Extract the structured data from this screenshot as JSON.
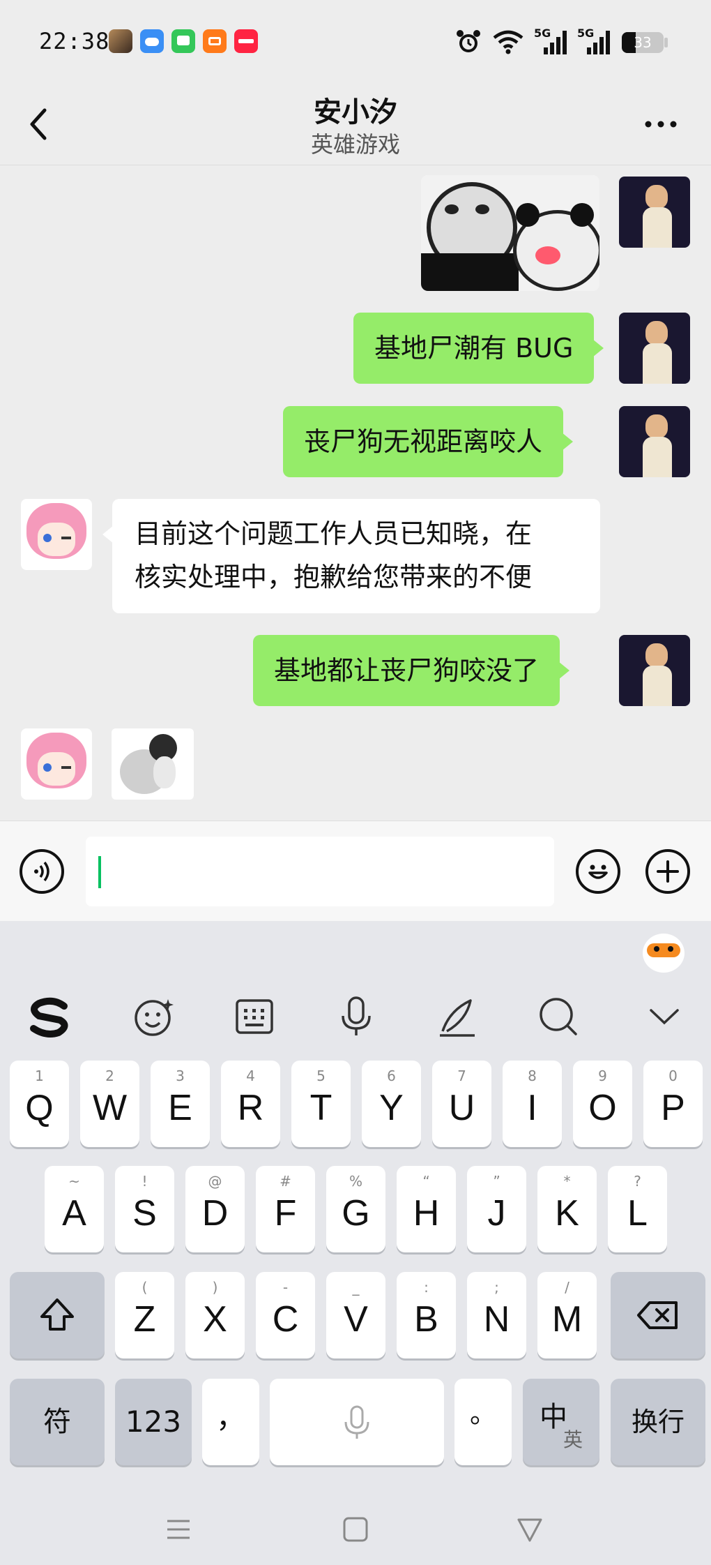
{
  "status": {
    "time": "22:38",
    "signal1": "5G",
    "signal2": "5G",
    "battery": "33"
  },
  "header": {
    "title": "安小汐",
    "subtitle": "英雄游戏"
  },
  "messages": [
    {
      "side": "right",
      "kind": "sticker"
    },
    {
      "side": "right",
      "text": "基地尸潮有 BUG"
    },
    {
      "side": "right",
      "text": "丧尸狗无视距离咬人"
    },
    {
      "side": "left",
      "line1": "目前这个问题工作人员已知晓，在",
      "line2": "核实处理中，抱歉给您带来的不便"
    },
    {
      "side": "right",
      "text": "基地都让丧尸狗咬没了"
    },
    {
      "side": "left",
      "kind": "sticker"
    }
  ],
  "keyboard": {
    "row1": [
      {
        "hint": "1",
        "key": "Q"
      },
      {
        "hint": "2",
        "key": "W"
      },
      {
        "hint": "3",
        "key": "E"
      },
      {
        "hint": "4",
        "key": "R"
      },
      {
        "hint": "5",
        "key": "T"
      },
      {
        "hint": "6",
        "key": "Y"
      },
      {
        "hint": "7",
        "key": "U"
      },
      {
        "hint": "8",
        "key": "I"
      },
      {
        "hint": "9",
        "key": "O"
      },
      {
        "hint": "0",
        "key": "P"
      }
    ],
    "row2": [
      {
        "hint": "~",
        "key": "A"
      },
      {
        "hint": "!",
        "key": "S"
      },
      {
        "hint": "@",
        "key": "D"
      },
      {
        "hint": "#",
        "key": "F"
      },
      {
        "hint": "%",
        "key": "G"
      },
      {
        "hint": "“",
        "key": "H"
      },
      {
        "hint": "”",
        "key": "J"
      },
      {
        "hint": "*",
        "key": "K"
      },
      {
        "hint": "?",
        "key": "L"
      }
    ],
    "row3": [
      {
        "hint": "(",
        "key": "Z"
      },
      {
        "hint": ")",
        "key": "X"
      },
      {
        "hint": "-",
        "key": "C"
      },
      {
        "hint": "_",
        "key": "V"
      },
      {
        "hint": ":",
        "key": "B"
      },
      {
        "hint": ";",
        "key": "N"
      },
      {
        "hint": "/",
        "key": "M"
      }
    ],
    "fu": "符",
    "num": "123",
    "comma": "，",
    "period": "。",
    "zh": "中",
    "en": "英",
    "enter": "换行"
  },
  "colors": {
    "bubble_green": "#95ec69",
    "cursor": "#07c160"
  }
}
